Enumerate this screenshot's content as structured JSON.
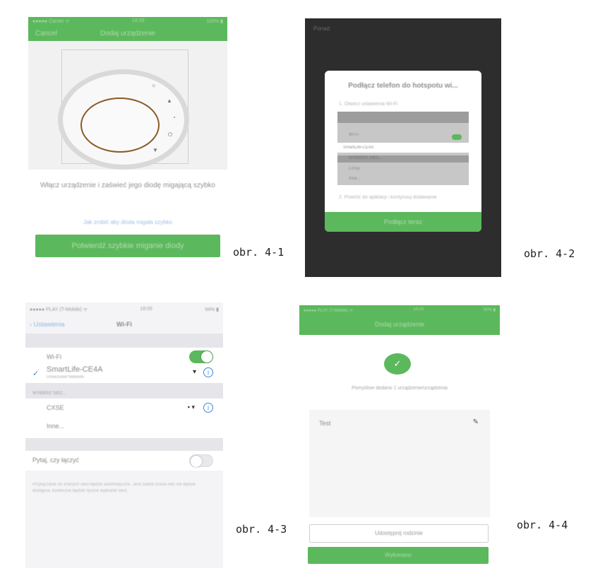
{
  "colors": {
    "accent_green": "#5cb85c",
    "ios_blue": "#3f86d8",
    "dark_bg": "#2d2d2d"
  },
  "panel1": {
    "status_left": "●●●●● Carrier ᯤ",
    "status_time": "14:29",
    "status_right": "100% ▮",
    "back_label": "Cancel",
    "title": "Dodaj urządzenie",
    "tick_labels": [
      "☼",
      "▲",
      "◔",
      "⏻",
      "▼"
    ],
    "message": "Włącz urządzenie i zaświeć jego diodę migającą szybko",
    "link": "Jak zrobić aby dioda migała szybko",
    "confirm_button": "Potwierdź szybkie miganie diody",
    "caption": "obr. 4-1"
  },
  "panel2": {
    "corner_text": "Ponad",
    "dialog_title": "Podłącz telefon do hotspotu wi...",
    "step1": "1. Otwórz ustawienia Wi-Fi",
    "shot_rows": [
      "Wi-Fi",
      "SmartLife-CE4A",
      "WYBIERZ SIEĆ...",
      "CXSE",
      "Inne..."
    ],
    "step2": "2. Powróć do aplikacji i kontynuuj dodawanie",
    "dialog_button": "Podłącz teraz",
    "caption": "obr. 4-2"
  },
  "panel3": {
    "status_left": "●●●●● PLAY (T-Mobile) ᯤ",
    "status_time": "18:05",
    "status_right": "94% ▮",
    "back_label": "Ustawienia",
    "title": "Wi-Fi",
    "wifi_label": "Wi-Fi",
    "network_name": "SmartLife-CE4A",
    "network_sub": "Unsecured Network",
    "choose_header": "WYBIERZ SIEĆ...",
    "other_network": "CXSE",
    "other_label": "Inne...",
    "ask_label": "Pytaj, czy łączyć",
    "ask_desc": "Przyłączanie do znanych sieci będzie automatyczne. Jeśli żadna znana sieć nie będzie dostępna, konieczne będzie ręczne wybranie sieci.",
    "caption": "obr. 4-3"
  },
  "panel4": {
    "status_left": "●●●●● PLAY (T-Mobile) ᯤ",
    "status_time": "14:29",
    "status_right": "90% ▮",
    "title": "Dodaj urządzenie",
    "ok_icon": "✓",
    "ok_message": "Pomyślnie dodano 1 urządzenie/urządzenia",
    "device_name": "Test",
    "share_button": "Udostępnij rodzinie",
    "done_button": "Wykonano",
    "caption": "obr. 4-4"
  }
}
